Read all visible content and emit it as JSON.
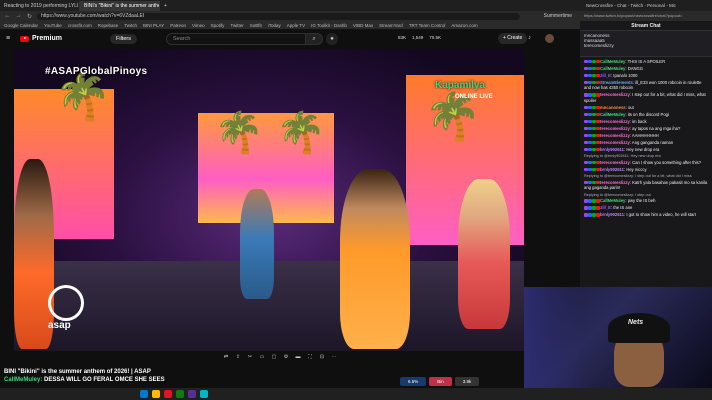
{
  "browser": {
    "tabs": [
      {
        "label": "Reacting to 2019 performing LYLI",
        "active": false
      },
      {
        "label": "BINI's \"Bikini\" is the summer anthem",
        "active": true
      }
    ],
    "url": "https://www.youtube.com/watch?v=6VZdaaLEI",
    "right_url": "Summertime",
    "bookmarks": [
      "Google Calendar",
      "YouTube",
      "crossfit.com",
      "Ropebase",
      "Twitch",
      "BINI PLAY",
      "Patreon",
      "Vimeo",
      "Spotify",
      "Twitter",
      "SoBfit",
      "iToday",
      "Apple TV",
      "IG Toolkit - Dashb",
      "VIBD Max",
      "StreamYard",
      "TRT Team Control",
      "Amazon.com"
    ]
  },
  "youtube": {
    "logo_label": "Premium",
    "filters_label": "Filters",
    "search_placeholder": "Search",
    "stats": [
      "83K",
      "1,549",
      "70.5K"
    ],
    "create_label": "+ Create"
  },
  "video": {
    "hashtag": "#ASAPGlobalPinoys",
    "network_logo": "Kapamilya",
    "network_sub": "ONLINE LIVE",
    "show_logo": "asap",
    "title_strip": "BINI \"Bikini\" is the summer anthem of 2026! | ASAP",
    "caption_user": "CallMeMuley:",
    "caption_text": "DESSA WILL GO FERAL OMCE SHE SEES",
    "bottom_buttons": [
      "6.5%",
      "Bin",
      "3.9k"
    ]
  },
  "chat": {
    "tab_label": "NewCrossfire - Chat - Twitch - Personal - Mic",
    "address": "https://www.twitch.tv/popout/newcrossfire/chat?popout=",
    "header": "Stream Chat",
    "pinned": [
      "mncanoness",
      "massaaa5",
      "terecomeslizzy"
    ],
    "messages": [
      {
        "name": "CallMeMuley",
        "color": "#3ed87a",
        "text": "THIS IS A SPOILER"
      },
      {
        "name": "CallMeMuley",
        "color": "#3ed87a",
        "text": "DANGG"
      },
      {
        "name": "Jill_E",
        "color": "#9b59ff",
        "text": "Ipanalo 1000"
      },
      {
        "name": "StreamElements",
        "color": "#6aa0ff",
        "text": "ill_E33 won 1000 robcoin in roulette and now has 4350 robcoin"
      },
      {
        "name": "terecomeslizzy",
        "color": "#ff6ad5",
        "text": "I step out for a bit, what did I miss, what spoiler"
      },
      {
        "name": "mncanoness",
        "color": "#ff8c3a",
        "text": "out"
      },
      {
        "name": "CallMeMuley",
        "color": "#3ed87a",
        "text": "its on the discord Pogi"
      },
      {
        "name": "terecomeslizzy",
        "color": "#ff6ad5",
        "text": "im back"
      },
      {
        "name": "terecomeslizzy",
        "color": "#ff6ad5",
        "text": "ay tapos na ang mga iha?"
      },
      {
        "name": "terecomeslizzy",
        "color": "#ff6ad5",
        "text": "AAHHHHHHH"
      },
      {
        "name": "terecomeslizzy",
        "color": "#ff6ad5",
        "text": "Ang ganganda naman"
      },
      {
        "name": "brnly902611",
        "color": "#c080ff",
        "text": "Hey new drop era"
      },
      {
        "name": "terecomeslizzy",
        "color": "#ff6ad5",
        "text": "Can I show you something after this?"
      },
      {
        "name": "brnly902611",
        "color": "#c080ff",
        "text": "Hey nicccy"
      },
      {
        "name": "terecomeslizzy",
        "color": "#ff6ad5",
        "text": "Katrh yala basahan pakasit mo sa kanila ang gaganda parin!"
      },
      {
        "name": "CallMeMuley",
        "color": "#3ed87a",
        "text": "pwy the IS beh"
      },
      {
        "name": "Jill_E",
        "color": "#9b59ff",
        "text": "the IS ane"
      },
      {
        "name": "brnly902611",
        "color": "#c080ff",
        "text": "I got to show him a video, he will start"
      }
    ],
    "replies": [
      "Replying to @brnly902611: Hey new drop era",
      "Replying to @terecomeslizzy: I step out for a bit, what did I miss",
      "Replying to @terecomeslizzy: I step out"
    ]
  },
  "taskbar": {
    "colors": [
      "#0078d4",
      "#ffb900",
      "#e81123",
      "#107c10",
      "#5c2d91",
      "#00b7c3"
    ]
  }
}
